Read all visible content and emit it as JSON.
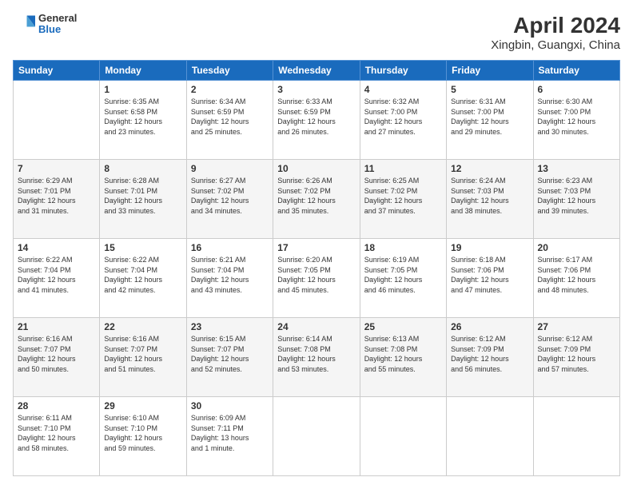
{
  "header": {
    "logo": {
      "general": "General",
      "blue": "Blue"
    },
    "title": "April 2024",
    "subtitle": "Xingbin, Guangxi, China"
  },
  "weekdays": [
    "Sunday",
    "Monday",
    "Tuesday",
    "Wednesday",
    "Thursday",
    "Friday",
    "Saturday"
  ],
  "weeks": [
    [
      {
        "day": "",
        "info": ""
      },
      {
        "day": "1",
        "info": "Sunrise: 6:35 AM\nSunset: 6:58 PM\nDaylight: 12 hours\nand 23 minutes."
      },
      {
        "day": "2",
        "info": "Sunrise: 6:34 AM\nSunset: 6:59 PM\nDaylight: 12 hours\nand 25 minutes."
      },
      {
        "day": "3",
        "info": "Sunrise: 6:33 AM\nSunset: 6:59 PM\nDaylight: 12 hours\nand 26 minutes."
      },
      {
        "day": "4",
        "info": "Sunrise: 6:32 AM\nSunset: 7:00 PM\nDaylight: 12 hours\nand 27 minutes."
      },
      {
        "day": "5",
        "info": "Sunrise: 6:31 AM\nSunset: 7:00 PM\nDaylight: 12 hours\nand 29 minutes."
      },
      {
        "day": "6",
        "info": "Sunrise: 6:30 AM\nSunset: 7:00 PM\nDaylight: 12 hours\nand 30 minutes."
      }
    ],
    [
      {
        "day": "7",
        "info": "Sunrise: 6:29 AM\nSunset: 7:01 PM\nDaylight: 12 hours\nand 31 minutes."
      },
      {
        "day": "8",
        "info": "Sunrise: 6:28 AM\nSunset: 7:01 PM\nDaylight: 12 hours\nand 33 minutes."
      },
      {
        "day": "9",
        "info": "Sunrise: 6:27 AM\nSunset: 7:02 PM\nDaylight: 12 hours\nand 34 minutes."
      },
      {
        "day": "10",
        "info": "Sunrise: 6:26 AM\nSunset: 7:02 PM\nDaylight: 12 hours\nand 35 minutes."
      },
      {
        "day": "11",
        "info": "Sunrise: 6:25 AM\nSunset: 7:02 PM\nDaylight: 12 hours\nand 37 minutes."
      },
      {
        "day": "12",
        "info": "Sunrise: 6:24 AM\nSunset: 7:03 PM\nDaylight: 12 hours\nand 38 minutes."
      },
      {
        "day": "13",
        "info": "Sunrise: 6:23 AM\nSunset: 7:03 PM\nDaylight: 12 hours\nand 39 minutes."
      }
    ],
    [
      {
        "day": "14",
        "info": "Sunrise: 6:22 AM\nSunset: 7:04 PM\nDaylight: 12 hours\nand 41 minutes."
      },
      {
        "day": "15",
        "info": "Sunrise: 6:22 AM\nSunset: 7:04 PM\nDaylight: 12 hours\nand 42 minutes."
      },
      {
        "day": "16",
        "info": "Sunrise: 6:21 AM\nSunset: 7:04 PM\nDaylight: 12 hours\nand 43 minutes."
      },
      {
        "day": "17",
        "info": "Sunrise: 6:20 AM\nSunset: 7:05 PM\nDaylight: 12 hours\nand 45 minutes."
      },
      {
        "day": "18",
        "info": "Sunrise: 6:19 AM\nSunset: 7:05 PM\nDaylight: 12 hours\nand 46 minutes."
      },
      {
        "day": "19",
        "info": "Sunrise: 6:18 AM\nSunset: 7:06 PM\nDaylight: 12 hours\nand 47 minutes."
      },
      {
        "day": "20",
        "info": "Sunrise: 6:17 AM\nSunset: 7:06 PM\nDaylight: 12 hours\nand 48 minutes."
      }
    ],
    [
      {
        "day": "21",
        "info": "Sunrise: 6:16 AM\nSunset: 7:07 PM\nDaylight: 12 hours\nand 50 minutes."
      },
      {
        "day": "22",
        "info": "Sunrise: 6:16 AM\nSunset: 7:07 PM\nDaylight: 12 hours\nand 51 minutes."
      },
      {
        "day": "23",
        "info": "Sunrise: 6:15 AM\nSunset: 7:07 PM\nDaylight: 12 hours\nand 52 minutes."
      },
      {
        "day": "24",
        "info": "Sunrise: 6:14 AM\nSunset: 7:08 PM\nDaylight: 12 hours\nand 53 minutes."
      },
      {
        "day": "25",
        "info": "Sunrise: 6:13 AM\nSunset: 7:08 PM\nDaylight: 12 hours\nand 55 minutes."
      },
      {
        "day": "26",
        "info": "Sunrise: 6:12 AM\nSunset: 7:09 PM\nDaylight: 12 hours\nand 56 minutes."
      },
      {
        "day": "27",
        "info": "Sunrise: 6:12 AM\nSunset: 7:09 PM\nDaylight: 12 hours\nand 57 minutes."
      }
    ],
    [
      {
        "day": "28",
        "info": "Sunrise: 6:11 AM\nSunset: 7:10 PM\nDaylight: 12 hours\nand 58 minutes."
      },
      {
        "day": "29",
        "info": "Sunrise: 6:10 AM\nSunset: 7:10 PM\nDaylight: 12 hours\nand 59 minutes."
      },
      {
        "day": "30",
        "info": "Sunrise: 6:09 AM\nSunset: 7:11 PM\nDaylight: 13 hours\nand 1 minute."
      },
      {
        "day": "",
        "info": ""
      },
      {
        "day": "",
        "info": ""
      },
      {
        "day": "",
        "info": ""
      },
      {
        "day": "",
        "info": ""
      }
    ]
  ]
}
